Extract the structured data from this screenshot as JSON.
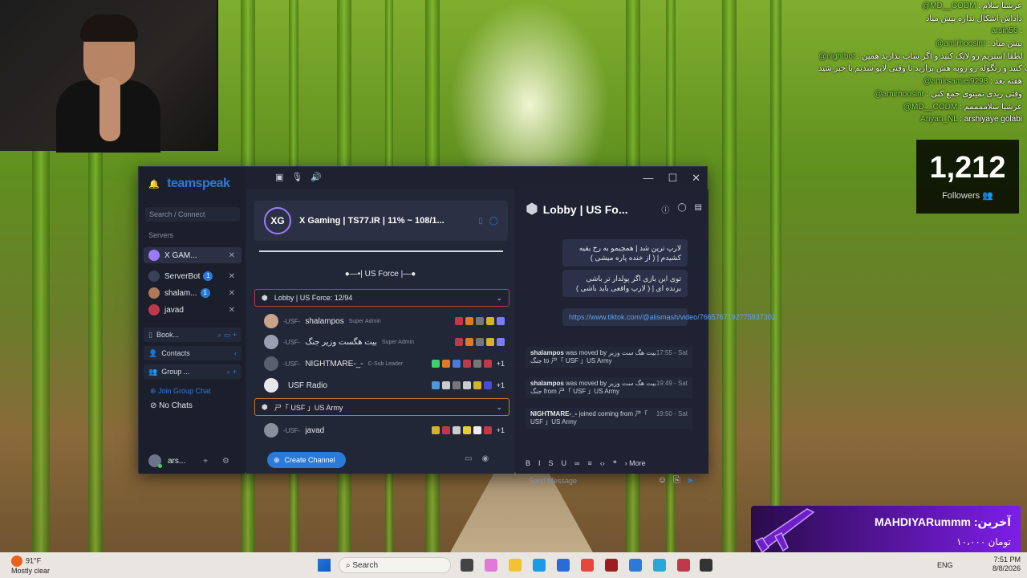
{
  "stream": {
    "chat": [
      {
        "user": "@MD__CODM",
        "text": "عرشیا سلام"
      },
      {
        "user": "",
        "text": "داداش اشکال نداره پیش میاد"
      },
      {
        "user": "arsin56",
        "text": ""
      },
      {
        "user": "@amirhoosinr",
        "text": "پیش میاد"
      },
      {
        "user": "@nightbot",
        "text": "لطفا استریم رو لایک کنید و اگر ساب ندارید همین"
      },
      {
        "user": "",
        "text": "الا ساب کنید و زنگوله رو روبه هش بزارید تا وقتی لایو شدیم با خبر شید"
      },
      {
        "user": "@amirsamiei9298",
        "text": "هفته بعد"
      },
      {
        "user": "@amirhoosinr",
        "text": "وقتی ریدی تمیتوی جمع کنی"
      },
      {
        "user": "@MD__CODM",
        "text": "عرشیا سلاممممم"
      },
      {
        "user": "Ariyan_NL",
        "text": "arshiyaye golabi"
      }
    ],
    "followers": {
      "count": "1,212",
      "label": "Followers"
    },
    "donation": {
      "name": "MAHDIYARummm :آخرین",
      "amount": "۱۰،۰۰۰ تومان"
    }
  },
  "teamspeak": {
    "logo": "teamspeak",
    "search_placeholder": "Search / Connect",
    "servers_title": "Servers",
    "servers": [
      {
        "label": "X GAM...",
        "badge": "",
        "color": "#9b7bff"
      },
      {
        "label": "ServerBot",
        "badge": "1",
        "color": "#3a4055"
      },
      {
        "label": "shalam...",
        "badge": "1",
        "color": "#b07a5a"
      },
      {
        "label": "javad",
        "badge": "",
        "color": "#c0394b"
      }
    ],
    "bookmarks_label": "Book...",
    "contacts_label": "Contacts",
    "groups_label": "Group ...",
    "join_group_chat": "Join Group Chat",
    "no_chats": "No Chats",
    "me": "ars...",
    "server_name": "X Gaming | TS77.IR | 11% ~ 108/1...",
    "server_logo_text": "XG",
    "spacer": "●—•| US Force |—●",
    "lobby_channel": "Lobby | US Force: 12/94",
    "army_channel": "ㄕ「 USF 」US Army",
    "members": [
      {
        "tag": "-USF-",
        "name": "shalampos",
        "rank": "Super Admin",
        "plus": ""
      },
      {
        "tag": "-USF-",
        "name": "بیت هگست وزیر جنگ",
        "rank": "Super Admin",
        "plus": ""
      },
      {
        "tag": "-USF-",
        "name": "NIGHTMARE-_-",
        "rank": "C-Sub Leader",
        "plus": "+1"
      },
      {
        "tag": "",
        "name": "USF Radio",
        "rank": "",
        "plus": "+1"
      }
    ],
    "army_members": [
      {
        "tag": "-USF-",
        "name": "javad",
        "rank": "",
        "plus": "+1"
      }
    ],
    "create_channel": "Create Channel",
    "chat_title": "Lobby | US Fo...",
    "messages": [
      "لارپ ترین شد | همچیمو به رخ بقیه کشیدم | ( از خنده پاره میشی )",
      "توی این بازی اگر پولدار تر باشی برنده ای | ( لارپ واقعی باید باشی )",
      "https://www.tiktok.com/@alismash/video/7665767192775937302"
    ],
    "system_messages": [
      {
        "who": "shalampos",
        "text": "was moved by بیت هگ ست وزیر جنگ to ㄕ「 USF 」US Army",
        "time": "17:55 - Sat"
      },
      {
        "who": "shalampos",
        "text": "was moved by بیت هگ ست وزیر جنگ from ㄕ「 USF 」US Army",
        "time": "19:49 - Sat"
      },
      {
        "who": "NIGHTMARE-_-",
        "text": "joined coming from ㄕ「 USF 」US Army",
        "time": "19:50 - Sat"
      }
    ],
    "format_more": "More",
    "send_placeholder": "Send Message"
  },
  "taskbar": {
    "temp": "91°F",
    "weather": "Mostly clear",
    "search": "Search",
    "lang": "ENG",
    "time": "7:51 PM",
    "date": "8/8/2026"
  }
}
